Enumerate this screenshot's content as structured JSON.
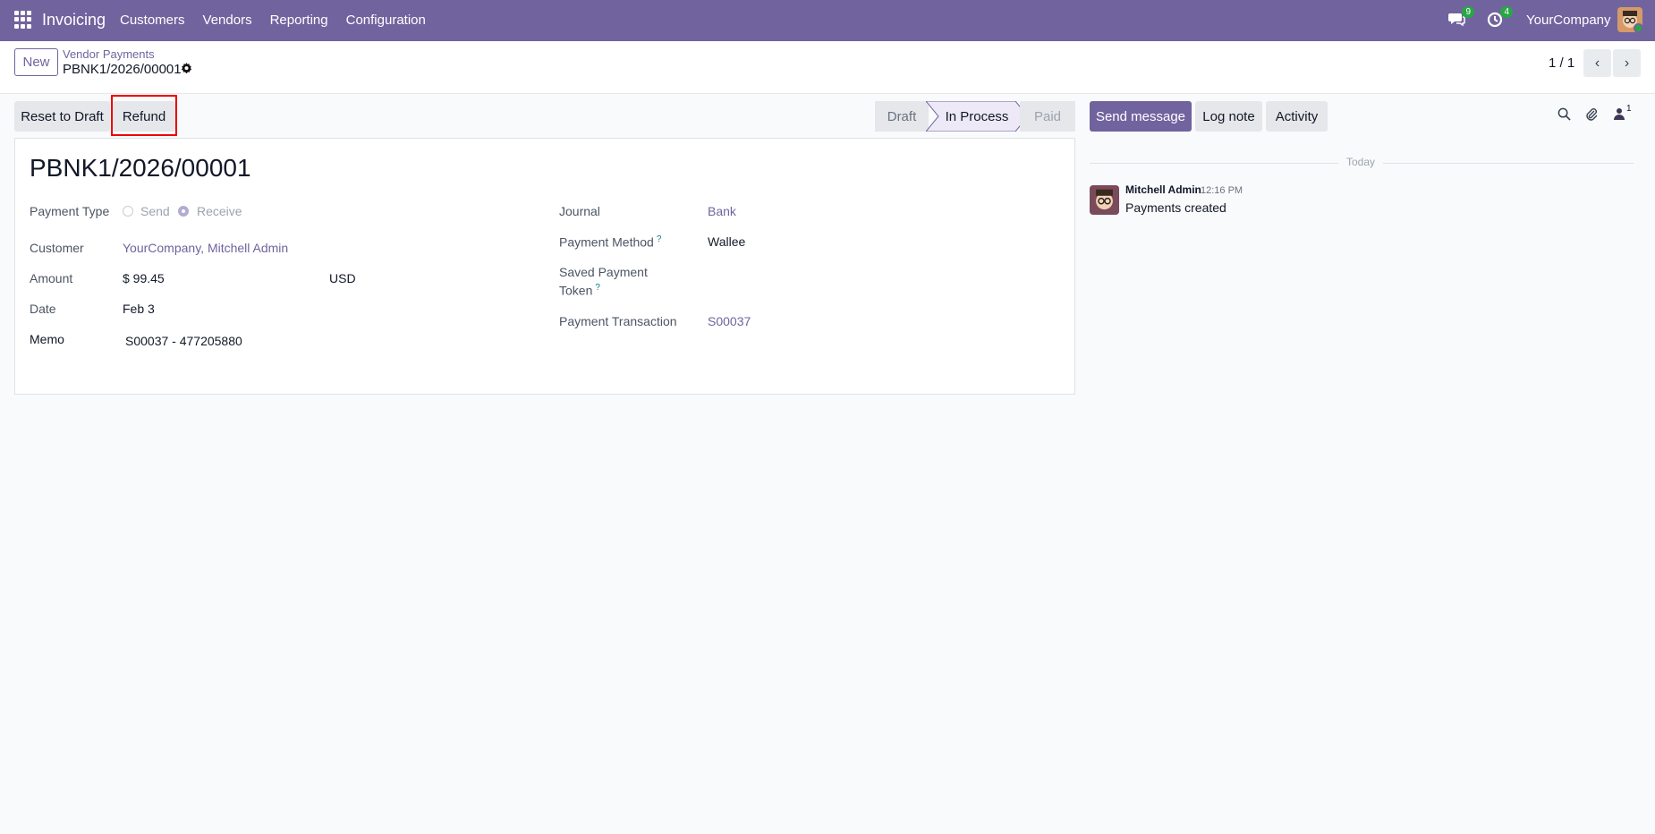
{
  "navbar": {
    "brand": "Invoicing",
    "menu": [
      "Customers",
      "Vendors",
      "Reporting",
      "Configuration"
    ],
    "messages_badge": "9",
    "activities_badge": "4",
    "company": "YourCompany"
  },
  "control_panel": {
    "new_label": "New",
    "breadcrumb_parent": "Vendor Payments",
    "breadcrumb_current": "PBNK1/2026/00001",
    "pager": "1 / 1"
  },
  "actions": {
    "reset_label": "Reset to Draft",
    "refund_label": "Refund"
  },
  "statusbar": {
    "draft": "Draft",
    "in_process": "In Process",
    "paid": "Paid",
    "current": "In Process"
  },
  "form": {
    "title": "PBNK1/2026/00001",
    "payment_type_label": "Payment Type",
    "payment_type_options": [
      "Send",
      "Receive"
    ],
    "payment_type_selected": "Receive",
    "customer_label": "Customer",
    "customer_value": "YourCompany, Mitchell Admin",
    "amount_label": "Amount",
    "amount_value": "$ 99.45",
    "currency_value": "USD",
    "date_label": "Date",
    "date_value": "Feb 3",
    "memo_label": "Memo",
    "memo_value": "S00037 - 477205880",
    "journal_label": "Journal",
    "journal_value": "Bank",
    "payment_method_label": "Payment Method",
    "payment_method_value": "Wallee",
    "saved_token_label_1": "Saved Payment",
    "saved_token_label_2": "Token",
    "help_mark": "?",
    "transaction_label": "Payment Transaction",
    "transaction_value": "S00037"
  },
  "chatter": {
    "send_message": "Send message",
    "log_note": "Log note",
    "activity": "Activity",
    "followers_count": "1",
    "date_separator": "Today",
    "message": {
      "author": "Mitchell Admin",
      "time": "12:16 PM",
      "body": "Payments created"
    }
  },
  "colors": {
    "brand": "#71639e",
    "badge": "#28a745",
    "highlight": "#ee0000"
  }
}
